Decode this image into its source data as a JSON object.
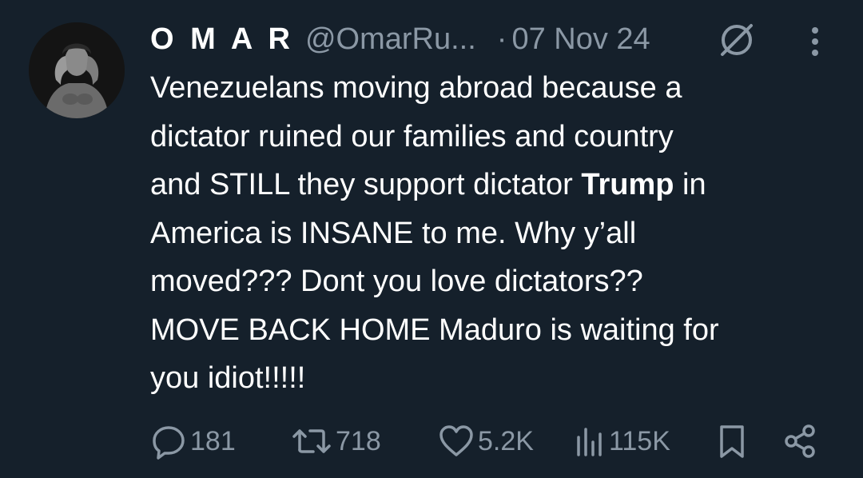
{
  "tweet": {
    "author": {
      "name": "O M A R",
      "handle": "@OmarRu...",
      "avatar_icon": "profile-photo"
    },
    "separator": "·",
    "date": "07 Nov 24",
    "grok_icon": "grok-icon",
    "more_icon": "more-vertical-icon",
    "text": {
      "line1": "Venezuelans moving abroad because a",
      "line2": "dictator ruined our families and country",
      "line3_pre": "and STILL they support dictator ",
      "line3_bold": "Trump",
      "line3_post": " in",
      "line4": "America is INSANE to me. Why y’all",
      "line5": "moved??? Dont you love dictators??",
      "line6": "MOVE BACK HOME Maduro is waiting for",
      "line7": "you idiot!!!!!"
    },
    "actions": {
      "replies": "181",
      "retweets": "718",
      "likes": "5.2K",
      "views": "115K"
    }
  },
  "colors": {
    "background": "#15202b",
    "primary_text": "#ffffff",
    "secondary_text": "#8b98a5"
  }
}
